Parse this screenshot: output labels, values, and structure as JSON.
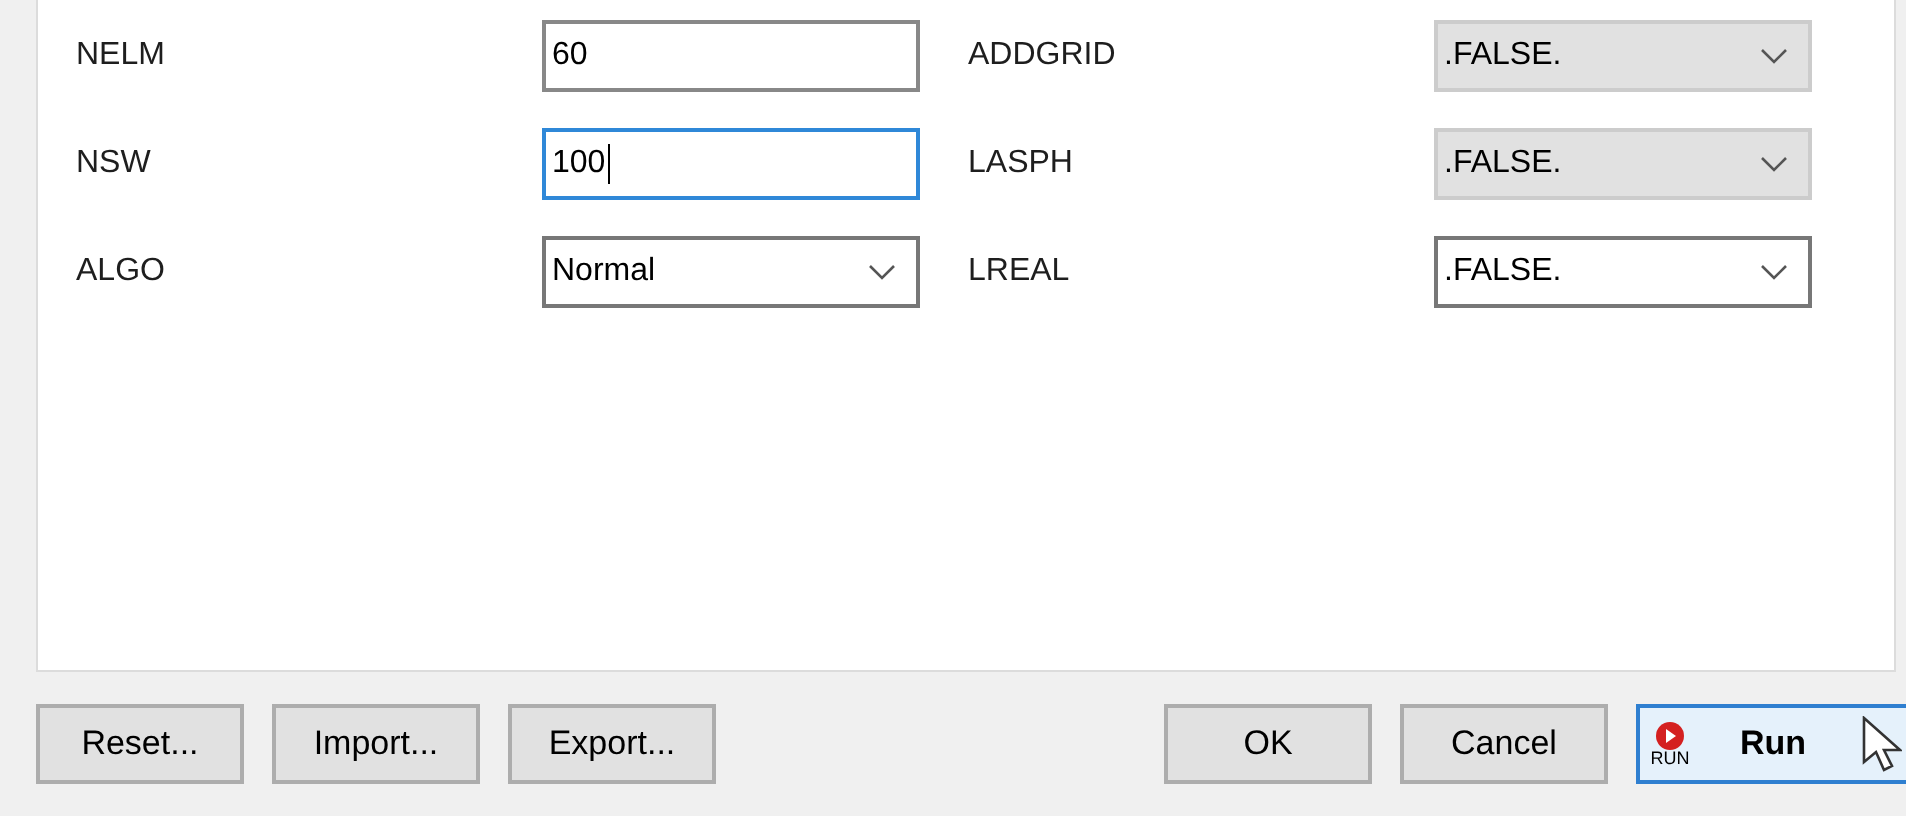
{
  "parameters": [
    {
      "label": "NELM",
      "field": {
        "kind": "text",
        "value": "60",
        "focused": false
      },
      "label_2": "ADDGRID",
      "field_2": {
        "kind": "combo",
        "value": ".FALSE.",
        "disabled": true
      }
    },
    {
      "label": "NSW",
      "field": {
        "kind": "text",
        "value": "100",
        "focused": true
      },
      "label_2": "LASPH",
      "field_2": {
        "kind": "combo",
        "value": ".FALSE.",
        "disabled": true
      }
    },
    {
      "label": "ALGO",
      "field": {
        "kind": "combo",
        "value": "Normal",
        "disabled": false
      },
      "label_2": "LREAL",
      "field_2": {
        "kind": "combo",
        "value": ".FALSE.",
        "disabled": false
      }
    }
  ],
  "buttons_left": [
    "Reset...",
    "Import...",
    "Export..."
  ],
  "buttons_right": [
    {
      "label": "OK",
      "default": false
    },
    {
      "label": "Cancel",
      "default": false
    }
  ],
  "run_button": {
    "label": "Run",
    "icon_text": "RUN",
    "default": true
  }
}
